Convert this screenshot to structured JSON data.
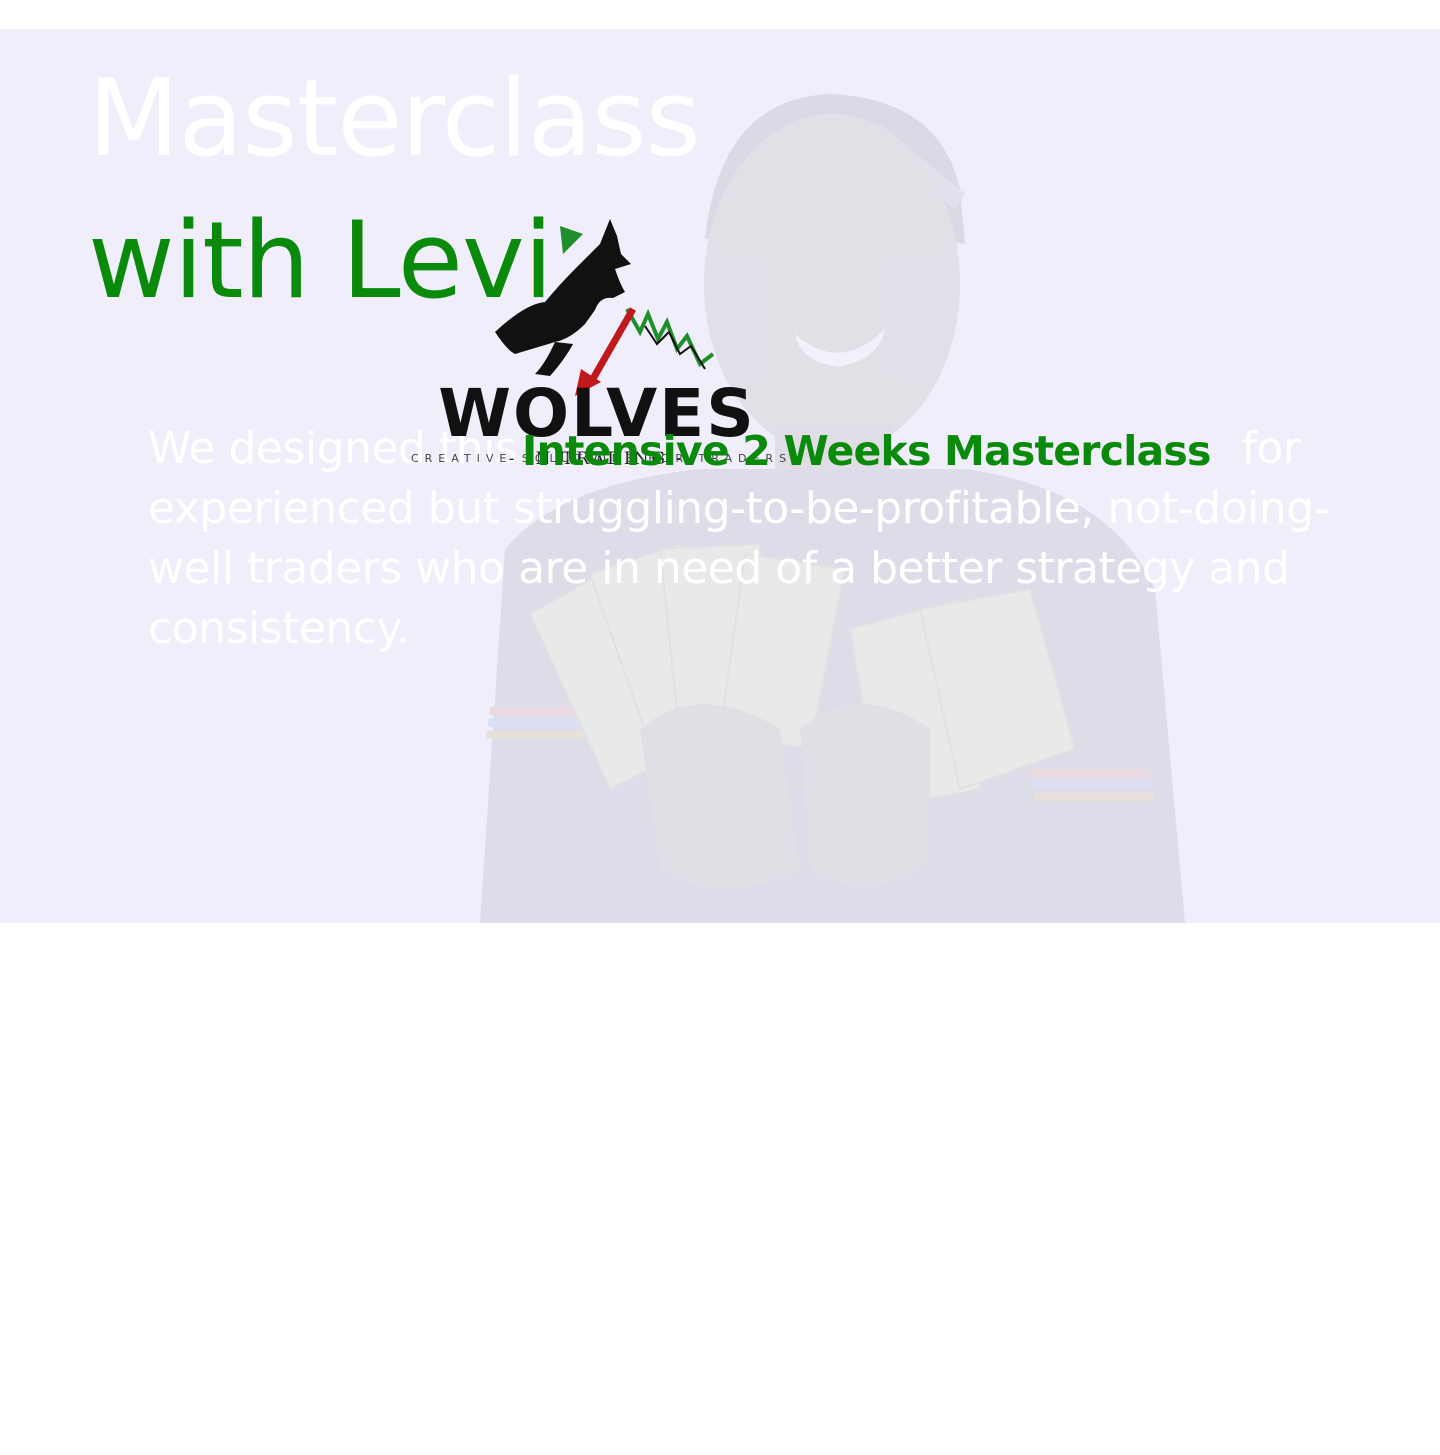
{
  "hero": {
    "title_line1": "Masterclass",
    "title_line2": "with Levi",
    "description_prefix": "We designed this ",
    "description_highlight": "Intensive 2 Weeks Masterclass",
    "description_suffix": " for experienced but struggling-to-be-profitable, not-doing-well traders who are in need of a better strategy and consistency."
  },
  "logo": {
    "wordmark": "WOLVES",
    "tagline": "- IN TRADING -",
    "subline": "CREATIVE SOLUTIONS FOR TRADERS"
  },
  "colors": {
    "accent_green": "#0a8a0a",
    "hero_background": "#efeefa",
    "page_background": "#ffffff"
  }
}
